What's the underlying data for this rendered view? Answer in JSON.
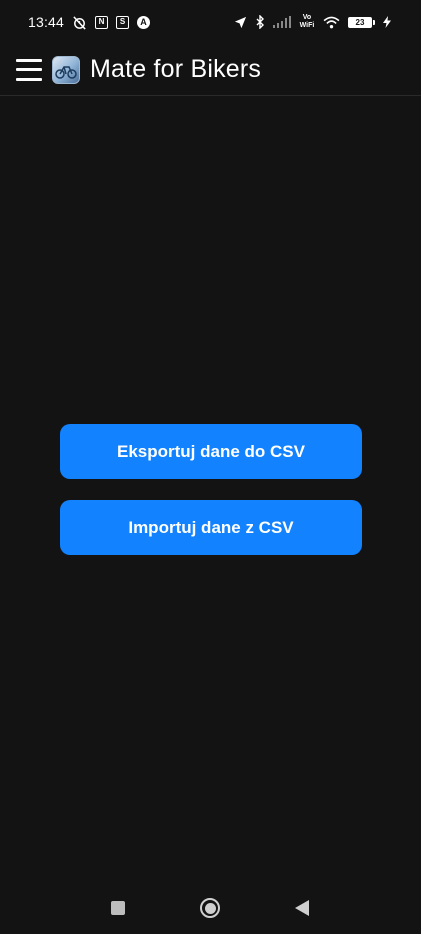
{
  "status_bar": {
    "time": "13:44",
    "left_icons": [
      "alarm-off-icon",
      "nfc-icon",
      "s-app-icon",
      "a-app-icon"
    ],
    "right_icons": [
      "location-arrow-icon",
      "bluetooth-icon",
      "signal-icon",
      "vowifi-icon",
      "wifi-icon"
    ],
    "vowifi_label": "Vo WiFi",
    "battery_level": "23",
    "charging": true
  },
  "app_bar": {
    "title": "Mate for Bikers",
    "menu_icon": "hamburger-menu-icon",
    "logo_icon": "app-logo-icon"
  },
  "actions": {
    "export_label": "Eksportuj dane do CSV",
    "import_label": "Importuj dane z CSV"
  },
  "nav_bar": {
    "items": [
      "recent-apps",
      "home",
      "back"
    ]
  },
  "colors": {
    "background": "#131313",
    "accent": "#1282ff",
    "text": "#ffffff"
  }
}
